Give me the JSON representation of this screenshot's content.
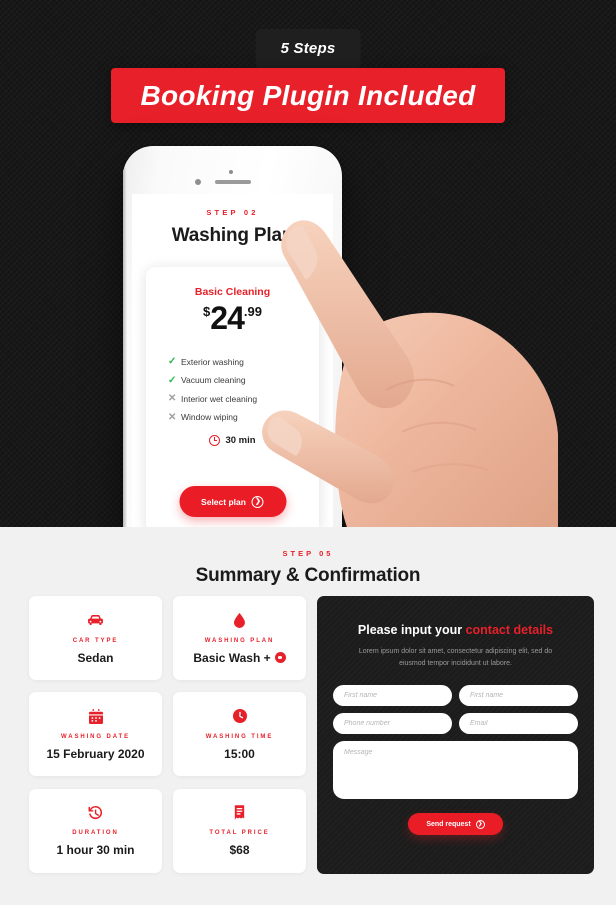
{
  "hero": {
    "steps_badge": "5 Steps",
    "title_banner": "Booking Plugin Included"
  },
  "phone_screen": {
    "step_kicker": "STEP 02",
    "title": "Washing Plan",
    "plan": {
      "name": "Basic Cleaning",
      "currency": "$",
      "price_whole": "24",
      "price_cents": ".99",
      "features": [
        {
          "mark": "check",
          "label": "Exterior washing"
        },
        {
          "mark": "check",
          "label": "Vacuum cleaning"
        },
        {
          "mark": "cross",
          "label": "Interior wet cleaning"
        },
        {
          "mark": "cross",
          "label": "Window wiping"
        }
      ],
      "duration": "30 min",
      "cta": "Select plan"
    }
  },
  "summary": {
    "kicker": "STEP 05",
    "title": "Summary & Confirmation",
    "cards": [
      {
        "icon": "car-icon",
        "label": "CAR TYPE",
        "value": "Sedan"
      },
      {
        "icon": "droplet-icon",
        "label": "WASHING PLAN",
        "value": "Basic Wash +",
        "badge": true
      },
      {
        "icon": "calendar-icon",
        "label": "WASHING DATE",
        "value": "15 February 2020"
      },
      {
        "icon": "clock-icon",
        "label": "WASHING TIME",
        "value": "15:00"
      },
      {
        "icon": "history-icon",
        "label": "DURATION",
        "value": "1 hour 30 min"
      },
      {
        "icon": "receipt-icon",
        "label": "TOTAL PRICE",
        "value": "$68"
      }
    ],
    "form": {
      "title_plain": "Please input your ",
      "title_accent": "contact details",
      "subtitle": "Lorem ipsum dolor sit amet, consectetur adipiscing elit, sed do eiusmod tempor incididunt ut labore.",
      "first_name_placeholder": "First name",
      "second_name_placeholder": "First name",
      "phone_placeholder": "Phone number",
      "email_placeholder": "Email",
      "message_placeholder": "Message",
      "submit_label": "Send request"
    }
  },
  "colors": {
    "accent_red": "#e8202a",
    "dark_bg": "#151515",
    "panel_bg": "#1c1c1c",
    "page_bg": "#f1f1f1",
    "check_green": "#2bb64a"
  }
}
